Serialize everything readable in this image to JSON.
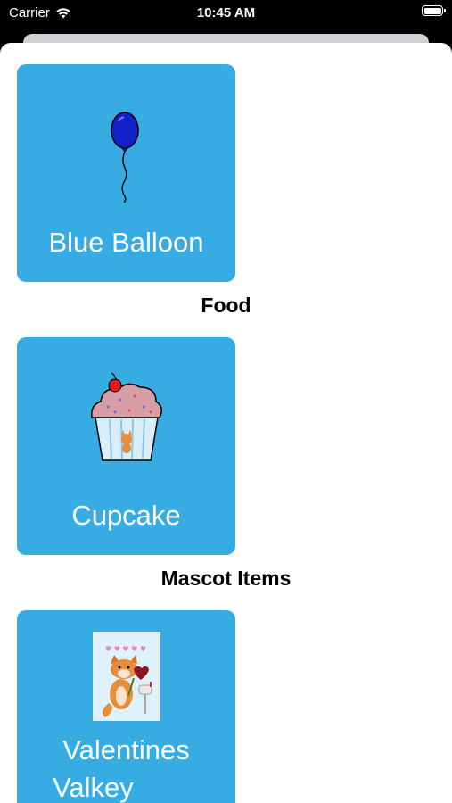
{
  "status_bar": {
    "carrier": "Carrier",
    "time": "10:45 AM",
    "wifi_icon": "wifi-icon",
    "battery_icon": "battery-icon"
  },
  "sections": [
    {
      "header": "",
      "items": [
        {
          "label": "Blue Balloon",
          "icon": "balloon-icon"
        }
      ]
    },
    {
      "header": "Food",
      "items": [
        {
          "label": "Cupcake",
          "icon": "cupcake-icon"
        }
      ]
    },
    {
      "header": "Mascot Items",
      "items": [
        {
          "label_line1": "Valentines",
          "label_line2": "Valkey",
          "icon": "valentines-fox-card-icon"
        }
      ]
    }
  ],
  "colors": {
    "card_background": "#36ace3",
    "card_text": "#ffffff",
    "balloon": "#1420c8"
  }
}
